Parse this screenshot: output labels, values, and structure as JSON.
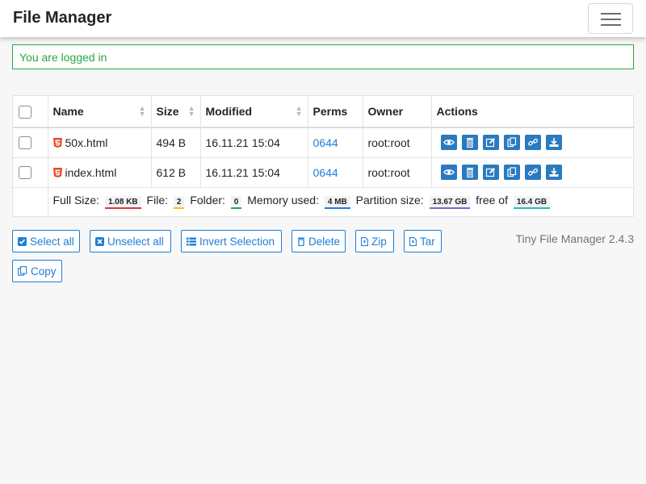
{
  "navbar": {
    "brand": "File Manager"
  },
  "alert": {
    "message": "You are logged in"
  },
  "table": {
    "columns": {
      "name": "Name",
      "size": "Size",
      "modified": "Modified",
      "perms": "Perms",
      "owner": "Owner",
      "actions": "Actions"
    },
    "rows": [
      {
        "name": "50x.html",
        "size": "494 B",
        "modified": "16.11.21 15:04",
        "perms": "0644",
        "owner": "root:root"
      },
      {
        "name": "index.html",
        "size": "612 B",
        "modified": "16.11.21 15:04",
        "perms": "0644",
        "owner": "root:root"
      }
    ],
    "footer": {
      "full_size_label": "Full Size:",
      "full_size": "1.08 KB",
      "file_label": "File:",
      "file_count": "2",
      "folder_label": "Folder:",
      "folder_count": "0",
      "memory_label": "Memory used:",
      "memory": "4 MB",
      "partition_label": "Partition size:",
      "partition": "13.67 GB",
      "free_label": "free of",
      "free": "16.4 GB"
    }
  },
  "buttons": {
    "select_all": "Select all",
    "unselect_all": "Unselect all",
    "invert_selection": "Invert Selection",
    "delete": "Delete",
    "zip": "Zip",
    "tar": "Tar",
    "copy": "Copy"
  },
  "version": "Tiny File Manager 2.4.3",
  "colors": {
    "accent": "#1e7fd6",
    "success": "#28a745",
    "action_button": "#2a7ac0",
    "html_icon": "#e34c26"
  }
}
